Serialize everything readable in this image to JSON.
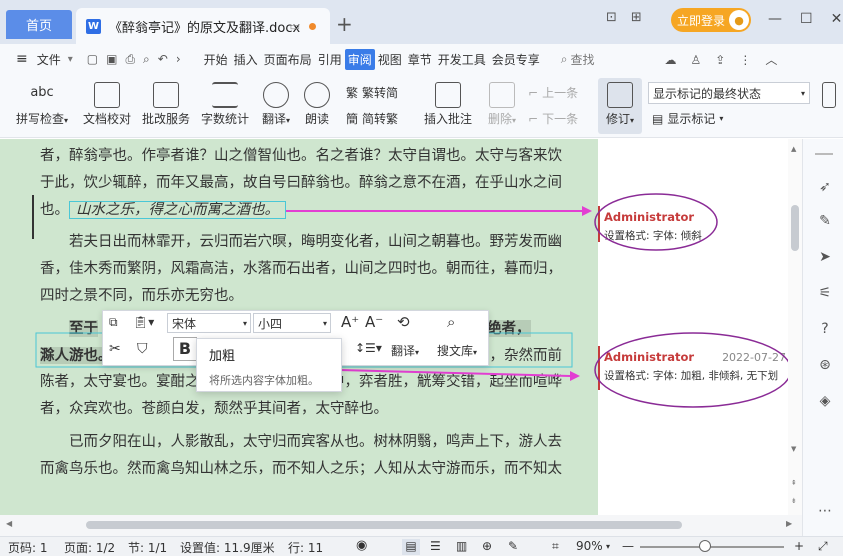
{
  "title_bar": {
    "home_tab": "首页",
    "doc_tab": "《醉翁亭记》的原文及翻译.docx",
    "login": "立即登录"
  },
  "menu": {
    "file": "文件",
    "items": [
      "开始",
      "插入",
      "页面布局",
      "引用",
      "审阅",
      "视图",
      "章节",
      "开发工具",
      "会员专享"
    ],
    "active": "审阅",
    "search": "查找"
  },
  "ribbon": {
    "spell": "拼写检查",
    "proof": "文档校对",
    "batch": "批改服务",
    "wordcount": "字数统计",
    "translate": "翻译",
    "read": "朗读",
    "trad": "繁转简",
    "simp": "简转繁",
    "insert_comment": "插入批注",
    "delete": "删除",
    "prev": "上一条",
    "next": "下一条",
    "revise": "修订",
    "markup_state": "显示标记的最终状态",
    "show_markup": "显示标记"
  },
  "document": {
    "p1_line1": "者，醉翁亭也。作亭者谁？山之僧智仙也。名之者谁？太守自谓也。太守与客来饮",
    "p1_line2": "于此，饮少辄醉，而年又最高，故自号曰醉翁也。醉翁之意不在酒，在乎山水之间",
    "p1_line3_a": "也。",
    "p1_line3_b": "山水之乐，得之心而寓之酒也。",
    "p2_line1": "若夫日出而林霏开，云归而岩穴暝，晦明变化者，山间之朝暮也。野芳发而幽",
    "p2_line2": "香，佳木秀而繁阴，风霜高洁，水落而石出者，山间之四时也。朝而往，暮而归，",
    "p2_line3": "四时之景不同，而乐亦无穷也。",
    "p3_line1_a": "至于",
    "p3_line1_b": "而不绝者，",
    "p3_line2_a": "滁人游也。",
    "p3_line2_b": "临溪而渔，溪深而鱼肥，酿泉为酒，泉香而酒洌，山肴野蔌，杂然而前",
    "p3_line3": "陈者，太守宴也。宴酣之乐，非丝非竹，射者中，弈者胜，觥筹交错，起坐而喧哗",
    "p3_line4": "者，众宾欢也。苍颜白发，颓然乎其间者，太守醉也。",
    "p4_line1": "已而夕阳在山，人影散乱，太守归而宾客从也。树林阴翳，鸣声上下，游人去",
    "p4_line2": "而禽鸟乐也。然而禽鸟知山林之乐，而不知人之乐；人知从太守游而乐，而不知太"
  },
  "comments": [
    {
      "author": "Administrator",
      "date": "",
      "body": "设置格式: 字体: 倾斜"
    },
    {
      "author": "Administrator",
      "date": "2022-07-27",
      "body": "设置格式: 字体: 加粗, 非倾斜, 无下划"
    }
  ],
  "mini_toolbar": {
    "font": "宋体",
    "size": "小四",
    "bold": "B",
    "translate": "翻译",
    "search_lib": "搜文库"
  },
  "tooltip": {
    "title": "加粗",
    "desc": "将所选内容字体加粗。"
  },
  "status": {
    "page": "页码: 1",
    "pages": "页面: 1/2",
    "section": "节: 1/1",
    "setting": "设置值: 11.9厘米",
    "row": "行: 11",
    "zoom": "90%"
  },
  "colors": {
    "accent": "#3a7ce8",
    "doc_bg": "#cfe6cf",
    "comment_red": "#c63b3b",
    "arrow": "#e23fd2"
  }
}
